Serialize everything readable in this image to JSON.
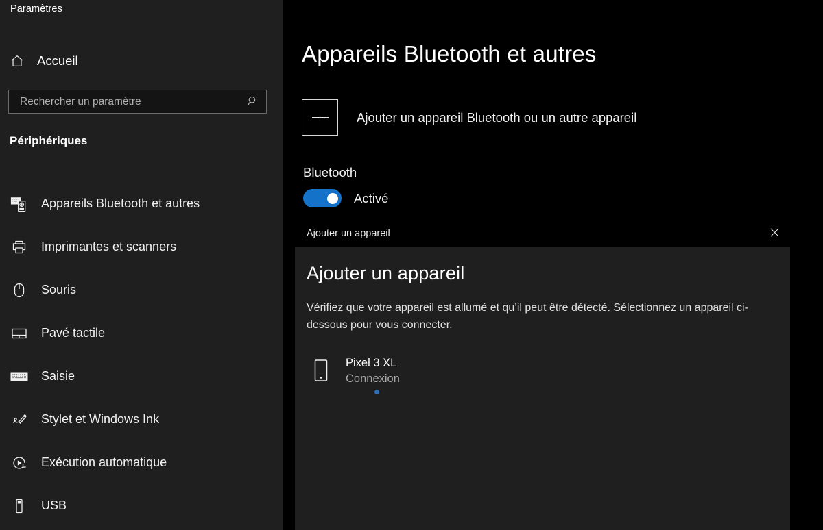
{
  "app": {
    "title": "Paramètres"
  },
  "sidebar": {
    "home": {
      "label": "Accueil",
      "icon": "home-icon"
    },
    "search": {
      "placeholder": "Rechercher un paramètre",
      "value": "",
      "icon": "search-icon"
    },
    "section_heading": "Périphériques",
    "items": [
      {
        "label": "Appareils Bluetooth et autres",
        "icon": "bluetooth-devices-icon",
        "selected": true
      },
      {
        "label": "Imprimantes et scanners",
        "icon": "printer-icon",
        "selected": false
      },
      {
        "label": "Souris",
        "icon": "mouse-icon",
        "selected": false
      },
      {
        "label": "Pavé tactile",
        "icon": "touchpad-icon",
        "selected": false
      },
      {
        "label": "Saisie",
        "icon": "keyboard-icon",
        "selected": false
      },
      {
        "label": "Stylet et Windows Ink",
        "icon": "pen-icon",
        "selected": false
      },
      {
        "label": "Exécution automatique",
        "icon": "autoplay-icon",
        "selected": false
      },
      {
        "label": "USB",
        "icon": "usb-icon",
        "selected": false
      }
    ]
  },
  "main": {
    "page_title": "Appareils Bluetooth et autres",
    "add_device": {
      "label": "Ajouter un appareil Bluetooth ou un autre appareil",
      "icon": "plus-icon"
    },
    "bluetooth": {
      "label": "Bluetooth",
      "state_label": "Activé",
      "enabled": true
    }
  },
  "dialog": {
    "titlebar_title": "Ajouter un appareil",
    "close_icon": "close-icon",
    "heading": "Ajouter un appareil",
    "description": "Vérifiez que votre appareil est allumé et qu’il peut être détecté. Sélectionnez un appareil ci-dessous pour vous connecter.",
    "devices": [
      {
        "name": "Pixel 3 XL",
        "status": "Connexion",
        "icon": "phone-icon",
        "busy": true
      }
    ]
  },
  "colors": {
    "accent": "#1473c8",
    "sidebar_bg": "#1f1f1f",
    "main_bg": "#000000",
    "dialog_bg": "#1f1f1f",
    "progress_dot": "#2b6fb8"
  }
}
